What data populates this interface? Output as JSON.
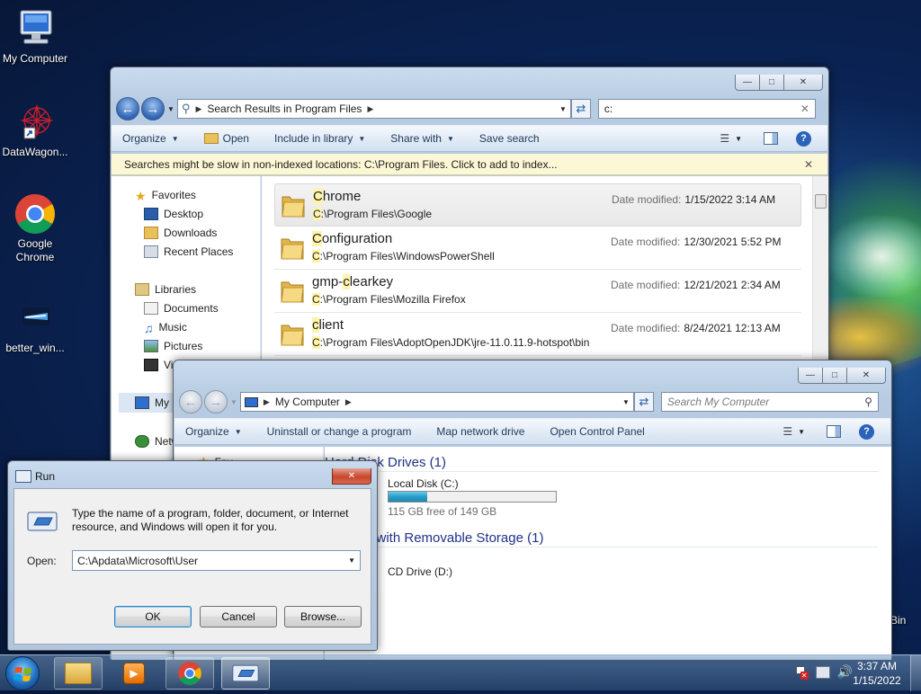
{
  "desktop": {
    "icons": [
      {
        "label": "My Computer"
      },
      {
        "label": "DataWagon..."
      },
      {
        "label": "Google Chrome"
      },
      {
        "label": "better_win..."
      }
    ],
    "partial_icon_label": "Bin"
  },
  "explorer_search": {
    "address": "Search Results in Program Files",
    "search_value": "c:",
    "toolbar": {
      "organize": "Organize",
      "open": "Open",
      "include_in_library": "Include in library",
      "share_with": "Share with",
      "save_search": "Save search"
    },
    "infobar": "Searches might be slow in non-indexed locations: C:\\Program Files. Click to add to index...",
    "nav": {
      "favorites": "Favorites",
      "desktop": "Desktop",
      "downloads": "Downloads",
      "recent_places": "Recent Places",
      "libraries": "Libraries",
      "documents": "Documents",
      "music": "Music",
      "pictures": "Pictures",
      "videos_partial": "Vi",
      "computer_partial": "My",
      "network_partial": "Netw"
    },
    "date_label": "Date modified:",
    "results": [
      {
        "name_hl": "C",
        "name_rest": "hrome",
        "path_hl": "C",
        "path_rest": ":\\Program Files\\Google",
        "date": "1/15/2022 3:14 AM"
      },
      {
        "name_hl": "C",
        "name_rest": "onfiguration",
        "path_hl": "C",
        "path_rest": ":\\Program Files\\WindowsPowerShell",
        "date": "12/30/2021 5:52 PM"
      },
      {
        "name_pre": "gmp-",
        "name_hl": "c",
        "name_rest": "learkey",
        "path_hl": "C",
        "path_rest": ":\\Program Files\\Mozilla Firefox",
        "date": "12/21/2021 2:34 AM"
      },
      {
        "name_hl": "c",
        "name_rest": "lient",
        "path_hl": "C",
        "path_rest": ":\\Program Files\\AdoptOpenJDK\\jre-11.0.11.9-hotspot\\bin",
        "date": "8/24/2021 12:13 AM"
      }
    ]
  },
  "explorer_computer": {
    "address": "My Computer",
    "search_placeholder": "Search My Computer",
    "toolbar": {
      "organize": "Organize",
      "uninstall": "Uninstall or change a program",
      "map_drive": "Map network drive",
      "control_panel": "Open Control Panel"
    },
    "group_hdd": "Hard Disk Drives (1)",
    "group_removable": "Devices with Removable Storage (1)",
    "local_disk": "Local Disk (C:)",
    "local_disk_free": "115 GB free of 149 GB",
    "local_disk_used_fraction": 0.23,
    "cd_drive": "CD Drive (D:)",
    "partial_label_favorites": "Fav"
  },
  "run_dialog": {
    "title": "Run",
    "description": "Type the name of a program, folder, document, or Internet resource, and Windows will open it for you.",
    "open_label": "Open:",
    "open_value": "C:\\Apdata\\Microsoft\\User",
    "ok": "OK",
    "cancel": "Cancel",
    "browse": "Browse..."
  },
  "taskbar": {
    "time": "3:37 AM",
    "date": "1/15/2022"
  }
}
